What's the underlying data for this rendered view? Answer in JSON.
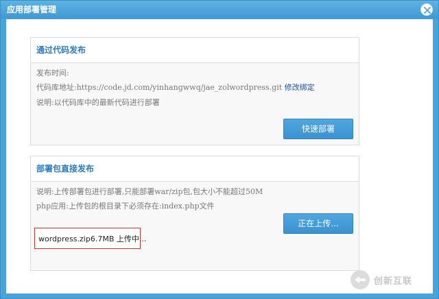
{
  "dialog": {
    "title": "应用部署管理",
    "close_icon": "close-icon"
  },
  "git_section": {
    "title": "通过代码发布",
    "publish_time_label": "发布时间:",
    "repo_label": "代码库地址:",
    "repo_url": "https://code.jd.com/yinhangwwq/jae_zolwordpress.git",
    "edit_link": "修改绑定",
    "note": "说明:以代码库中的最新代码进行部署",
    "deploy_button": "快速部署"
  },
  "package_section": {
    "title": "部署包直接发布",
    "note1": "说明:上传部署包进行部署,只能部署war/zip包,包大小不能超过50M",
    "note2": "php应用:上传包的根目录下必须存在:index.php文件",
    "upload_button": "正在上传...",
    "upload_status": "wordpress.zip6.7MB 上传中..."
  },
  "watermark": {
    "text": "创新互联",
    "icon": "logo-icon"
  },
  "colors": {
    "titlebar": "#4aa3d8",
    "accent": "#2a7bbf",
    "button": "#3a92d0",
    "highlight_border": "#d8322b"
  }
}
